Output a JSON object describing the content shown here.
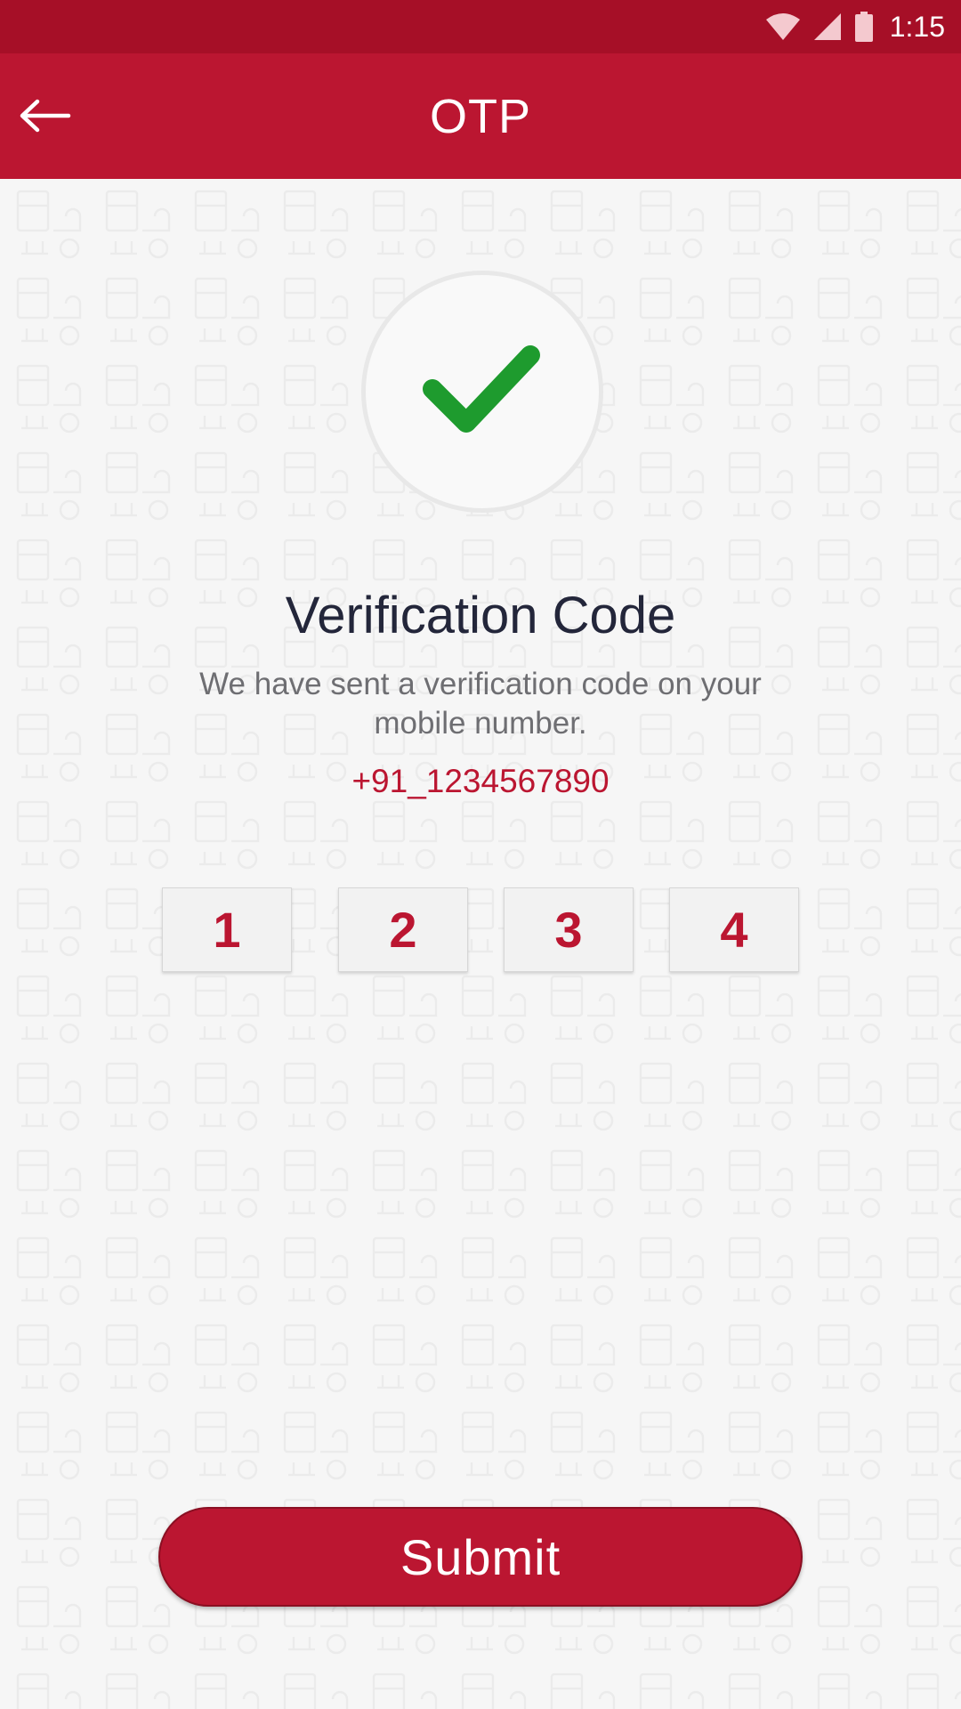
{
  "status_bar": {
    "time": "1:15",
    "icons": [
      "wifi-icon",
      "signal-icon",
      "battery-icon"
    ]
  },
  "app_bar": {
    "title": "OTP",
    "back_icon": "arrow-left-icon"
  },
  "hero": {
    "icon": "checkmark-icon",
    "icon_color": "#1e9b2e"
  },
  "content": {
    "title": "Verification Code",
    "subtitle": "We have sent a verification code on your mobile number.",
    "phone": "+91_1234567890"
  },
  "otp": {
    "digits": [
      "1",
      "2",
      "3",
      "4"
    ]
  },
  "submit": {
    "label": "Submit"
  },
  "colors": {
    "primary": "#bb1631",
    "primary_dark": "#a60f27",
    "background": "#f6f6f6"
  }
}
